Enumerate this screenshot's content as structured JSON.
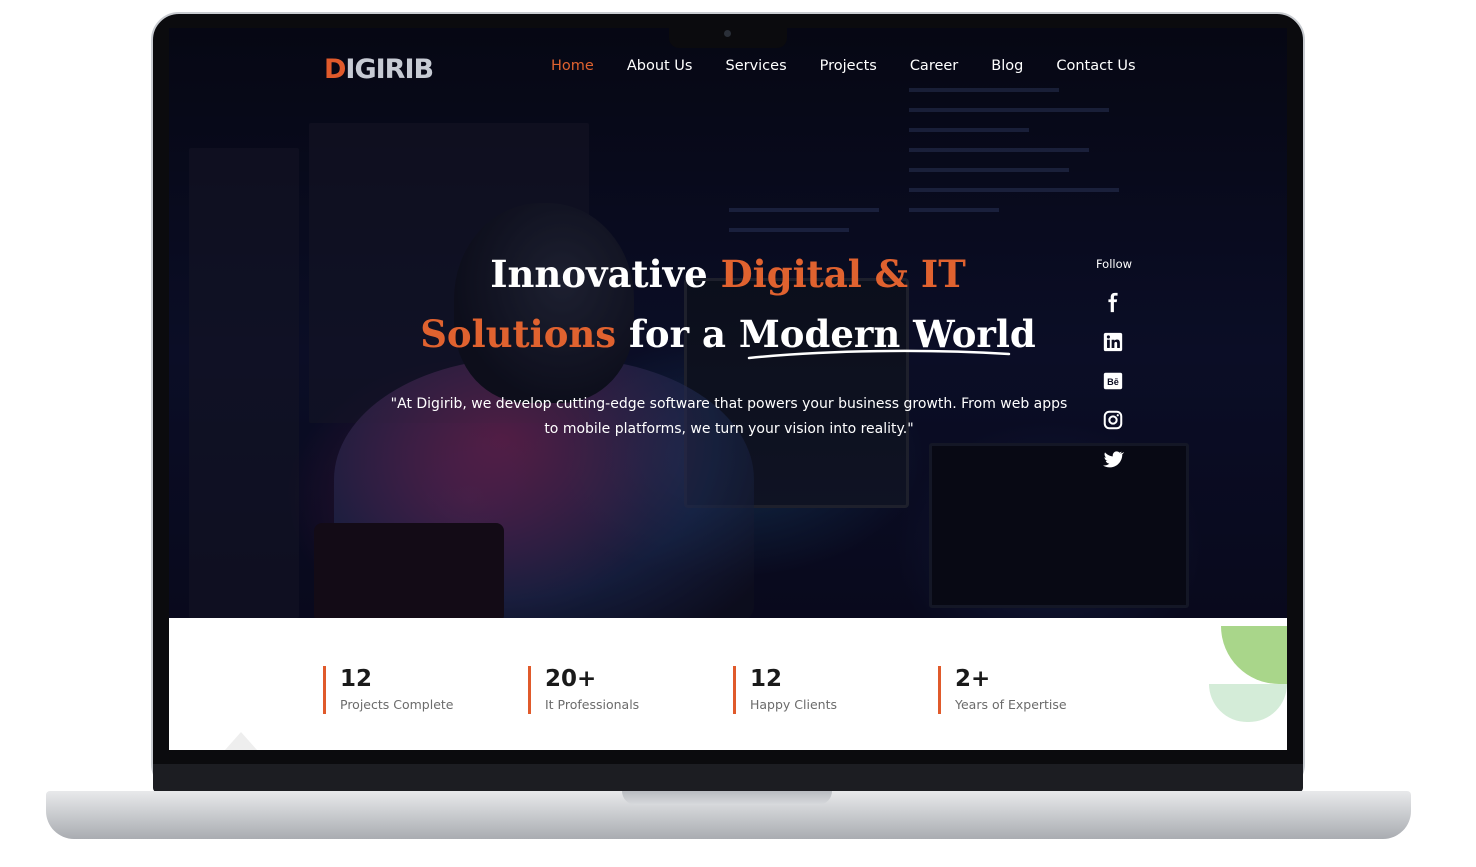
{
  "brand": {
    "logo_initial": "D",
    "logo_rest": "IGIRIB",
    "accent_color": "#e0622f"
  },
  "nav": {
    "items": [
      {
        "label": "Home",
        "active": true
      },
      {
        "label": "About Us"
      },
      {
        "label": "Services"
      },
      {
        "label": "Projects"
      },
      {
        "label": "Career"
      },
      {
        "label": "Blog"
      },
      {
        "label": "Contact Us"
      }
    ]
  },
  "hero": {
    "line1_plain": "Innovative ",
    "line1_accent": "Digital & IT",
    "line2_accent": "Solutions",
    "line2_plain": " for a Modern World",
    "subtext": "\"At Digirib, we develop cutting-edge software that powers your business growth. From web apps to mobile platforms, we turn your vision into reality.\""
  },
  "social": {
    "label": "Follow",
    "icons": [
      "facebook-icon",
      "linkedin-icon",
      "behance-icon",
      "instagram-icon",
      "twitter-icon"
    ]
  },
  "stats": [
    {
      "value": "12",
      "label": "Projects Complete"
    },
    {
      "value": "20+",
      "label": "It Professionals"
    },
    {
      "value": "12",
      "label": "Happy Clients"
    },
    {
      "value": "2+",
      "label": "Years of Expertise"
    }
  ]
}
